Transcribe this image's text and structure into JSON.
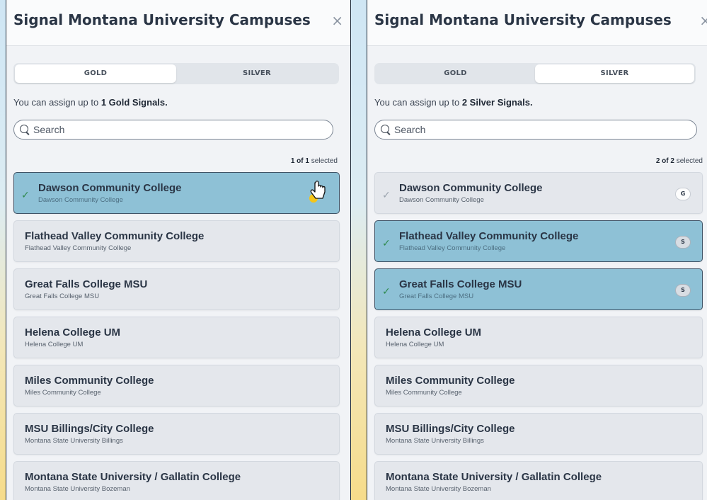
{
  "panels": [
    {
      "title": "Signal Montana University Campuses",
      "close_label": "×",
      "tabs": [
        {
          "label": "GOLD",
          "active": true
        },
        {
          "label": "SILVER",
          "active": false
        }
      ],
      "assign_prefix": "You can assign up to ",
      "assign_strong": "1 Gold Signals.",
      "search_placeholder": "Search",
      "count_strong": "1 of 1",
      "count_suffix": " selected",
      "items": [
        {
          "name": "Dawson Community College",
          "sub": "Dawson Community College",
          "selected": true,
          "check": true,
          "badge": ""
        },
        {
          "name": "Flathead Valley Community College",
          "sub": "Flathead Valley Community College",
          "selected": false,
          "check": false,
          "badge": ""
        },
        {
          "name": "Great Falls College MSU",
          "sub": "Great Falls College MSU",
          "selected": false,
          "check": false,
          "badge": ""
        },
        {
          "name": "Helena College UM",
          "sub": "Helena College UM",
          "selected": false,
          "check": false,
          "badge": ""
        },
        {
          "name": "Miles Community College",
          "sub": "Miles Community College",
          "selected": false,
          "check": false,
          "badge": ""
        },
        {
          "name": "MSU Billings/City College",
          "sub": "Montana State University Billings",
          "selected": false,
          "check": false,
          "badge": ""
        },
        {
          "name": "Montana State University / Gallatin College",
          "sub": "Montana State University Bozeman",
          "selected": false,
          "check": false,
          "badge": ""
        }
      ]
    },
    {
      "title": "Signal Montana University Campuses",
      "close_label": "×",
      "tabs": [
        {
          "label": "GOLD",
          "active": false
        },
        {
          "label": "SILVER",
          "active": true
        }
      ],
      "assign_prefix": "You can assign up to ",
      "assign_strong": "2 Silver Signals.",
      "search_placeholder": "Search",
      "count_strong": "2 of 2",
      "count_suffix": " selected",
      "items": [
        {
          "name": "Dawson Community College",
          "sub": "Dawson Community College",
          "selected": false,
          "check": true,
          "badge": "G"
        },
        {
          "name": "Flathead Valley Community College",
          "sub": "Flathead Valley Community College",
          "selected": true,
          "check": true,
          "badge": "S"
        },
        {
          "name": "Great Falls College MSU",
          "sub": "Great Falls College MSU",
          "selected": true,
          "check": true,
          "badge": "S"
        },
        {
          "name": "Helena College UM",
          "sub": "Helena College UM",
          "selected": false,
          "check": false,
          "badge": ""
        },
        {
          "name": "Miles Community College",
          "sub": "Miles Community College",
          "selected": false,
          "check": false,
          "badge": ""
        },
        {
          "name": "MSU Billings/City College",
          "sub": "Montana State University Billings",
          "selected": false,
          "check": false,
          "badge": ""
        },
        {
          "name": "Montana State University / Gallatin College",
          "sub": "Montana State University Bozeman",
          "selected": false,
          "check": false,
          "badge": ""
        }
      ]
    }
  ],
  "icons": {
    "check": "check-icon",
    "close": "close-icon",
    "search": "search-icon",
    "cursor": "hand-pointer-icon"
  },
  "colors": {
    "selected_bg": "#8ec1d6",
    "item_bg": "#e4e7ec",
    "check_green": "#2f8a4e"
  }
}
